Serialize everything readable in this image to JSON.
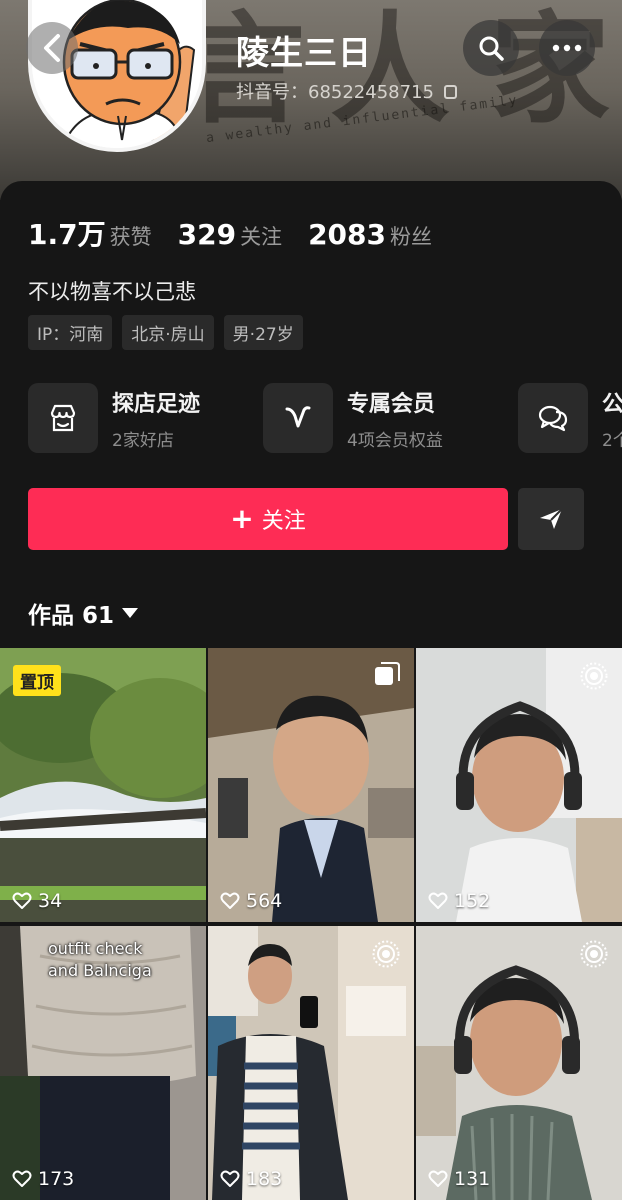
{
  "header": {
    "nickname": "陵生三日",
    "douyin_id": "抖音号：68522458715",
    "banner_text": "a wealthy and influential family",
    "banner_glyphs": [
      "言",
      "人",
      "家"
    ]
  },
  "stats": [
    {
      "num": "1.7万",
      "label": "获赞"
    },
    {
      "num": "329",
      "label": "关注"
    },
    {
      "num": "2083",
      "label": "粉丝"
    }
  ],
  "bio": "不以物喜不以己悲",
  "tags": [
    "IP：河南",
    "北京·房山",
    "男·27岁"
  ],
  "services": [
    {
      "icon": "shop-icon",
      "title": "探店足迹",
      "sub": "2家好店"
    },
    {
      "icon": "v-member-icon",
      "title": "专属会员",
      "sub": "4项会员权益"
    },
    {
      "icon": "chat-icon",
      "title": "公",
      "sub": "2个"
    }
  ],
  "actions": {
    "follow_label": "关注",
    "follow_plus": "+"
  },
  "works_tab": "作品 61",
  "videos": [
    {
      "likes": "34",
      "pinned": "置顶",
      "caption": "",
      "badge": "none"
    },
    {
      "likes": "564",
      "pinned": "",
      "caption": "",
      "badge": "multi-image-icon"
    },
    {
      "likes": "152",
      "pinned": "",
      "caption": "",
      "badge": "live-photo-icon"
    },
    {
      "likes": "173",
      "pinned": "",
      "caption_lines": [
        "outfit check",
        "and Balnciga"
      ],
      "badge": "none"
    },
    {
      "likes": "183",
      "pinned": "",
      "caption": "",
      "badge": "live-photo-icon"
    },
    {
      "likes": "131",
      "pinned": "",
      "caption": "",
      "badge": "live-photo-icon"
    }
  ],
  "colors": {
    "accent": "#fe2c55",
    "pin": "#ffe11b",
    "bg": "#161616"
  }
}
